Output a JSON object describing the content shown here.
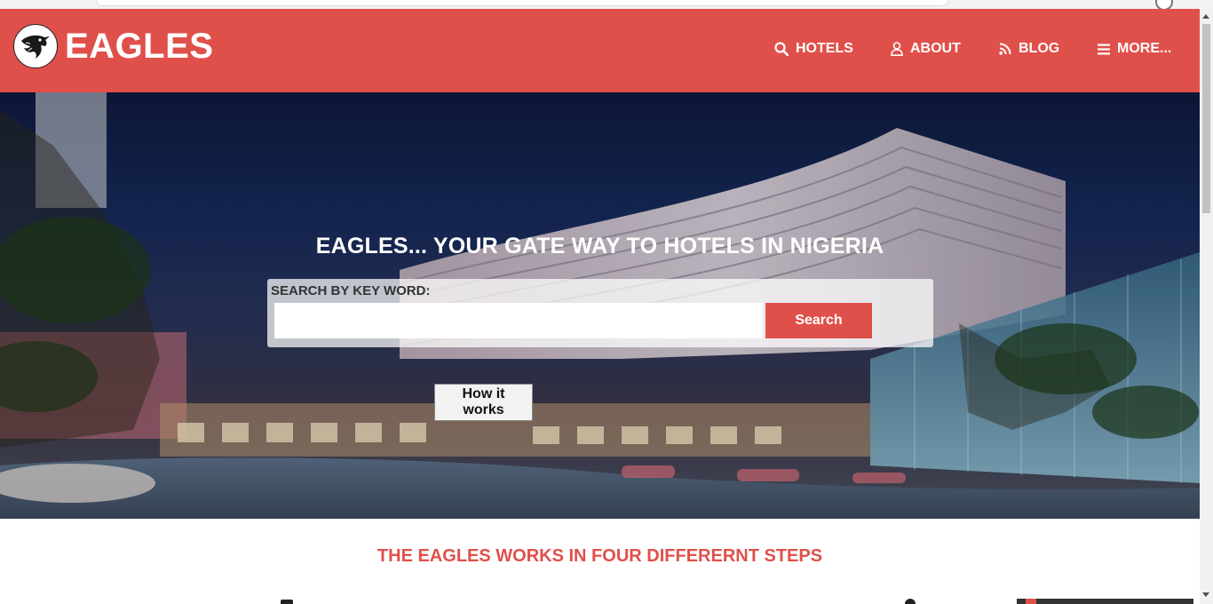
{
  "brand": {
    "name": "EAGLES",
    "logo_icon": "eagle-icon"
  },
  "nav": {
    "items": [
      {
        "label": "HOTELS",
        "icon": "search-icon"
      },
      {
        "label": "ABOUT",
        "icon": "user-icon"
      },
      {
        "label": "BLOG",
        "icon": "rss-icon"
      },
      {
        "label": "MORE...",
        "icon": "menu-icon"
      }
    ]
  },
  "hero": {
    "title": "EAGLES... YOUR GATE WAY TO HOTELS IN NIGERIA",
    "search_label": "SEARCH BY KEY WORD:",
    "search_value": "",
    "search_button": "Search",
    "how_button": "How it works"
  },
  "steps": {
    "heading": "THE EAGLES WORKS IN FOUR DIFFERERNT STEPS"
  },
  "colors": {
    "accent": "#e0504a",
    "text_on_accent": "#ffffff"
  }
}
